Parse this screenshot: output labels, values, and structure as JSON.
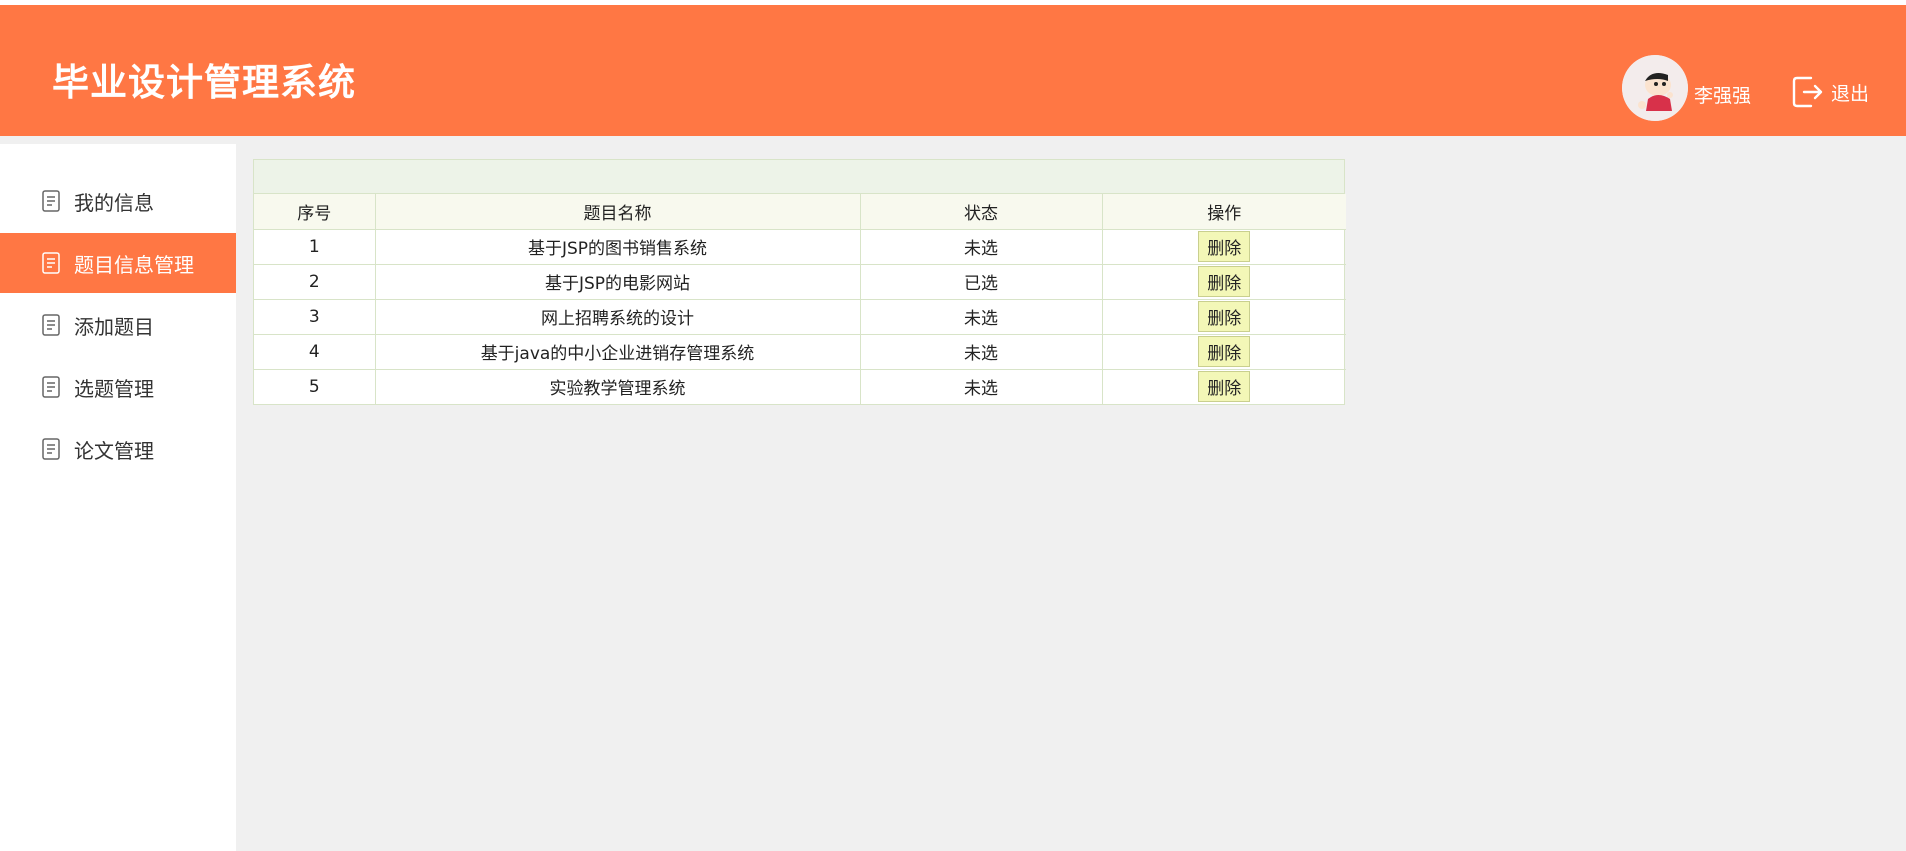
{
  "header": {
    "title": "毕业设计管理系统",
    "user_name": "李强强",
    "avatar_icon": "avatar-cartoon-icon",
    "logout_icon": "logout-icon",
    "logout_label": "退出",
    "accent_color": "#ff7744"
  },
  "sidebar": {
    "items": [
      {
        "label": "我的信息",
        "icon": "document-icon",
        "active": false
      },
      {
        "label": "题目信息管理",
        "icon": "document-icon",
        "active": true
      },
      {
        "label": "添加题目",
        "icon": "document-icon",
        "active": false
      },
      {
        "label": "选题管理",
        "icon": "document-icon",
        "active": false
      },
      {
        "label": "论文管理",
        "icon": "document-icon",
        "active": false
      }
    ]
  },
  "table": {
    "columns": [
      "序号",
      "题目名称",
      "状态",
      "操作"
    ],
    "rows": [
      {
        "no": "1",
        "name": "基于JSP的图书销售系统",
        "status": "未选",
        "action": "删除"
      },
      {
        "no": "2",
        "name": "基于JSP的电影网站",
        "status": "已选",
        "action": "删除"
      },
      {
        "no": "3",
        "name": "网上招聘系统的设计",
        "status": "未选",
        "action": "删除"
      },
      {
        "no": "4",
        "name": "基于java的中小企业进销存管理系统",
        "status": "未选",
        "action": "删除"
      },
      {
        "no": "5",
        "name": "实验教学管理系统",
        "status": "未选",
        "action": "删除"
      }
    ]
  }
}
